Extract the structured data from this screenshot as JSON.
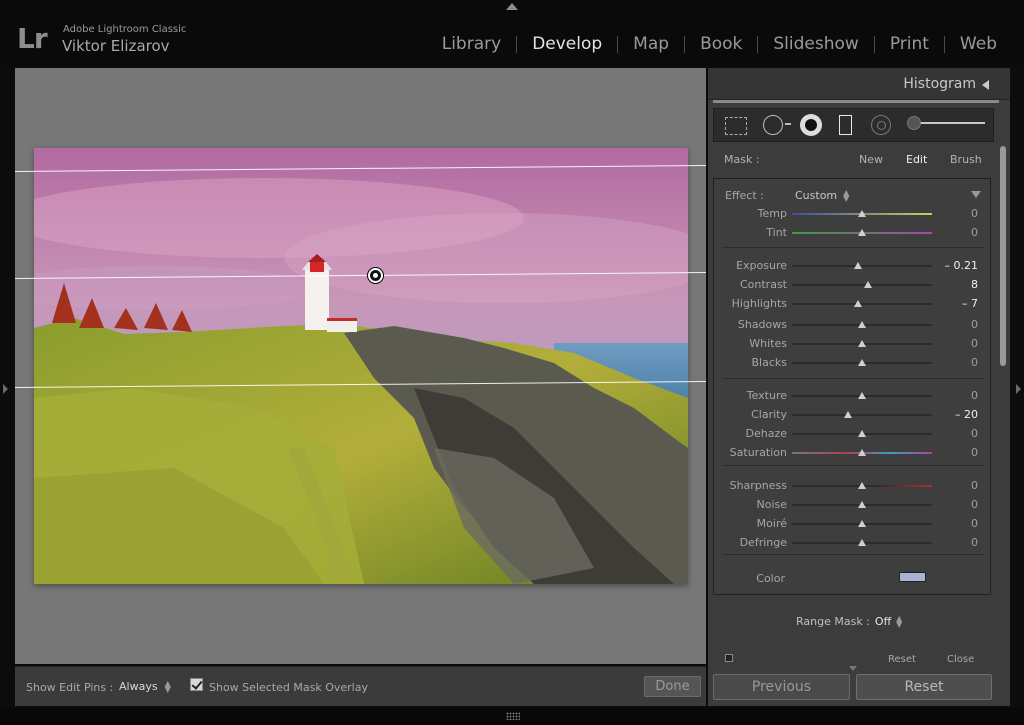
{
  "app": {
    "logo": "Lr",
    "product": "Adobe Lightroom Classic",
    "user": "Viktor Elizarov"
  },
  "modules": [
    {
      "label": "Library",
      "active": false
    },
    {
      "label": "Develop",
      "active": true
    },
    {
      "label": "Map",
      "active": false
    },
    {
      "label": "Book",
      "active": false
    },
    {
      "label": "Slideshow",
      "active": false
    },
    {
      "label": "Print",
      "active": false
    },
    {
      "label": "Web",
      "active": false
    }
  ],
  "toolbar": {
    "show_edit_pins_label": "Show Edit Pins :",
    "show_edit_pins_value": "Always",
    "mask_overlay_label": "Show Selected Mask Overlay",
    "mask_overlay_checked": true,
    "done_label": "Done"
  },
  "panel": {
    "histogram_title": "Histogram",
    "mask": {
      "label": "Mask :",
      "new": "New",
      "edit": "Edit",
      "brush": "Brush"
    },
    "effect": {
      "label": "Effect :",
      "value": "Custom"
    },
    "sliders": [
      {
        "name": "temp",
        "label": "Temp",
        "value": "0",
        "pos": 0.5,
        "highlight": false
      },
      {
        "name": "tint",
        "label": "Tint",
        "value": "0",
        "pos": 0.5,
        "highlight": false
      },
      {
        "name": "exposure",
        "label": "Exposure",
        "value": "– 0.21",
        "pos": 0.47,
        "highlight": true
      },
      {
        "name": "contrast",
        "label": "Contrast",
        "value": "8",
        "pos": 0.54,
        "highlight": true
      },
      {
        "name": "highlights",
        "label": "Highlights",
        "value": "– 7",
        "pos": 0.47,
        "highlight": true
      },
      {
        "name": "shadows",
        "label": "Shadows",
        "value": "0",
        "pos": 0.5,
        "highlight": false
      },
      {
        "name": "whites",
        "label": "Whites",
        "value": "0",
        "pos": 0.5,
        "highlight": false
      },
      {
        "name": "blacks",
        "label": "Blacks",
        "value": "0",
        "pos": 0.5,
        "highlight": false
      },
      {
        "name": "texture",
        "label": "Texture",
        "value": "0",
        "pos": 0.5,
        "highlight": false
      },
      {
        "name": "clarity",
        "label": "Clarity",
        "value": "– 20",
        "pos": 0.4,
        "highlight": true
      },
      {
        "name": "dehaze",
        "label": "Dehaze",
        "value": "0",
        "pos": 0.5,
        "highlight": false
      },
      {
        "name": "saturation",
        "label": "Saturation",
        "value": "0",
        "pos": 0.5,
        "highlight": false
      },
      {
        "name": "sharpness",
        "label": "Sharpness",
        "value": "0",
        "pos": 0.5,
        "highlight": false
      },
      {
        "name": "noise",
        "label": "Noise",
        "value": "0",
        "pos": 0.5,
        "highlight": false
      },
      {
        "name": "moire",
        "label": "Moiré",
        "value": "0",
        "pos": 0.5,
        "highlight": false
      },
      {
        "name": "defringe",
        "label": "Defringe",
        "value": "0",
        "pos": 0.5,
        "highlight": false
      }
    ],
    "color_label": "Color",
    "color_swatch": "#a8b2d4",
    "range_mask_label": "Range Mask :",
    "range_mask_value": "Off",
    "reset_small": "Reset",
    "close_small": "Close"
  },
  "buttons": {
    "previous": "Previous",
    "reset": "Reset"
  },
  "icons": {
    "crop": "crop-overlay-icon",
    "spot": "spot-removal-icon",
    "redeye": "red-eye-icon",
    "graduated": "graduated-filter-icon",
    "radial": "radial-filter-icon",
    "brush": "adjustment-brush-icon"
  }
}
